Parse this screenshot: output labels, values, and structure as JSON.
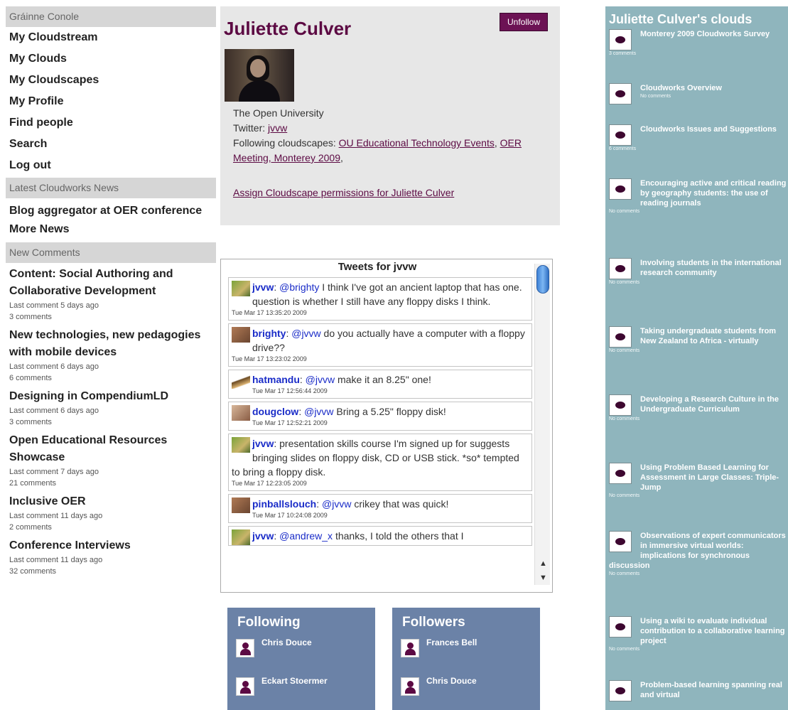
{
  "left": {
    "user_name": "Gráinne Conole",
    "nav": [
      "My Cloudstream",
      "My Clouds",
      "My Cloudscapes",
      "My Profile",
      "Find people",
      "Search",
      "Log out"
    ],
    "news_header": "Latest Cloudworks News",
    "news": [
      "Blog aggregator at OER conference",
      "More News"
    ],
    "comments_header": "New Comments",
    "comments": [
      {
        "title": "Content: Social Authoring and Collaborative Development",
        "last": "Last comment 5 days ago",
        "count": "3 comments"
      },
      {
        "title": "New technologies, new pedagogies with mobile devices",
        "last": "Last comment 6 days ago",
        "count": "6 comments"
      },
      {
        "title": "Designing in CompendiumLD",
        "last": "Last comment 6 days ago",
        "count": "3 comments"
      },
      {
        "title": "Open Educational Resources Showcase",
        "last": "Last comment 7 days ago",
        "count": "21 comments"
      },
      {
        "title": "Inclusive OER",
        "last": "Last comment 11 days ago",
        "count": "2 comments"
      },
      {
        "title": "Conference Interviews",
        "last": "Last comment 11 days ago",
        "count": "32 comments"
      }
    ]
  },
  "profile": {
    "name": "Juliette Culver",
    "unfollow_label": "Unfollow",
    "institution": "The Open University",
    "twitter_label": "Twitter:",
    "twitter_handle": "jvvw",
    "following_label": "Following cloudscapes:",
    "cloudscape_1": "OU Educational Technology Events",
    "cloudscape_2": "OER Meeting, Monterey 2009",
    "assign_link": "Assign Cloudscape permissions for Juliette Culver"
  },
  "tweets": {
    "title": "Tweets for jvvw",
    "items": [
      {
        "user": "jvvw",
        "pre": "",
        "mention": "@brighty",
        "text": " I think I've got an ancient laptop that has one. question is whether I still have any floppy disks I think.",
        "time": "Tue Mar 17 13:35:20 2009"
      },
      {
        "user": "brighty",
        "pre": "",
        "mention": "@jvvw",
        "text": " do you actually have a computer with a floppy drive??",
        "time": "Tue Mar 17 13:23:02 2009"
      },
      {
        "user": "hatmandu",
        "pre": "",
        "mention": "@jvvw",
        "text": " make it an 8.25\" one!",
        "time": "Tue Mar 17 12:56:44 2009"
      },
      {
        "user": "dougclow",
        "pre": "",
        "mention": "@jvvw",
        "text": " Bring a 5.25\" floppy disk!",
        "time": "Tue Mar 17 12:52:21 2009"
      },
      {
        "user": "jvvw",
        "pre": " presentation skills course I'm signed up for suggests bringing slides on floppy disk, CD or USB stick. *so* tempted to bring a floppy disk.",
        "mention": "",
        "text": "",
        "time": "Tue Mar 17 12:23:05 2009"
      },
      {
        "user": "pinballslouch",
        "pre": "",
        "mention": "@jvvw",
        "text": " crikey that was quick!",
        "time": "Tue Mar 17 10:24:08 2009"
      },
      {
        "user": "jvvw",
        "pre": "",
        "mention": "@andrew_x",
        "text": " thanks, I told the others that I",
        "time": ""
      }
    ]
  },
  "following": {
    "title": "Following",
    "people": [
      "Chris Douce",
      "Eckart Stoermer"
    ]
  },
  "followers": {
    "title": "Followers",
    "people": [
      "Frances Bell",
      "Chris Douce"
    ]
  },
  "clouds": {
    "title": "Juliette Culver's clouds",
    "items": [
      {
        "title": "Monterey 2009 Cloudworks Survey",
        "meta": "3 comments"
      },
      {
        "title": "Cloudworks Overview",
        "meta": "No comments"
      },
      {
        "title": "Cloudworks Issues and Suggestions",
        "meta": "6 comments"
      },
      {
        "title": "Encouraging active and critical reading by geography students: the use of reading journals",
        "meta": "No comments"
      },
      {
        "title": "Involving students in the international research community",
        "meta": "No comments"
      },
      {
        "title": "Taking undergraduate students from New Zealand to Africa - virtually",
        "meta": "No comments"
      },
      {
        "title": "Developing a Research Culture in the Undergraduate Curriculum",
        "meta": "No comments"
      },
      {
        "title": "Using Problem Based Learning for Assessment in Large Classes: Triple-Jump",
        "meta": "No comments"
      },
      {
        "title": "Observations of expert communicators in immersive virtual worlds: implications for synchronous discussion",
        "meta": "No comments"
      },
      {
        "title": "Using a wiki to evaluate individual contribution to a collaborative learning project",
        "meta": "No comments"
      },
      {
        "title": "Problem-based learning spanning real and virtual",
        "meta": ""
      }
    ]
  },
  "colors": {
    "brand": "#5c0a43",
    "clouds_panel": "#8fb5bd",
    "follow_box": "#6b82a7",
    "tweet_link": "#1a2cc8"
  }
}
